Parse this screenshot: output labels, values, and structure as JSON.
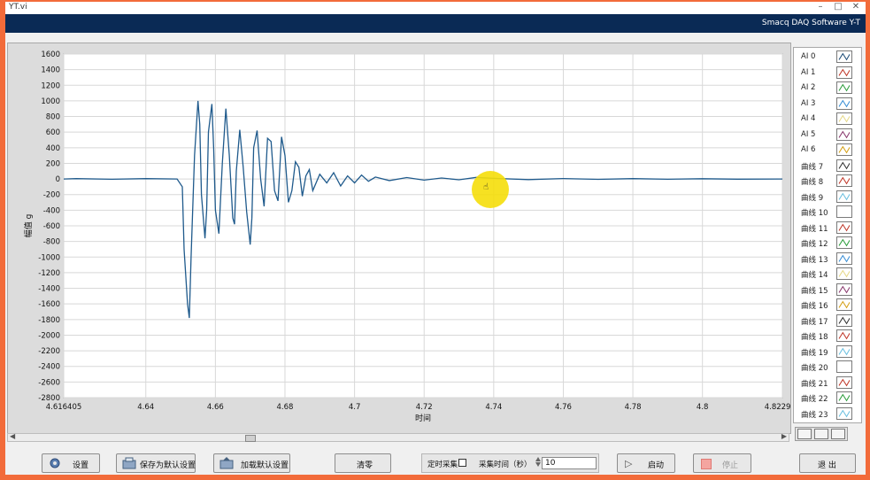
{
  "window": {
    "title": "YT.vi",
    "controls": [
      "–",
      "□",
      "✕"
    ],
    "brand": "Smacq DAQ Software Y-T"
  },
  "chart_data": {
    "type": "line",
    "xlabel": "时间",
    "ylabel": "幅值 g",
    "xlim": [
      4.616405,
      4.822974
    ],
    "ylim": [
      -2800,
      1600
    ],
    "x_ticks": [
      "4.616405",
      "4.64",
      "4.66",
      "4.68",
      "4.7",
      "4.72",
      "4.74",
      "4.76",
      "4.78",
      "4.8",
      "4.822974"
    ],
    "y_ticks": [
      "1600",
      "1400",
      "1200",
      "1000",
      "800",
      "600",
      "400",
      "200",
      "0",
      "-200",
      "-400",
      "-600",
      "-800",
      "-1000",
      "-1200",
      "-1400",
      "-1600",
      "-1800",
      "-2000",
      "-2200",
      "-2400",
      "-2600",
      "-2800"
    ],
    "grid": true,
    "line_color": "#1f5a8c",
    "series": [
      {
        "x": [
          4.616405,
          4.62,
          4.63,
          4.64,
          4.649,
          4.6505,
          4.651,
          4.652,
          4.6525,
          4.653,
          4.654,
          4.655,
          4.6555,
          4.656,
          4.657,
          4.6575,
          4.658,
          4.659,
          4.6595,
          4.66,
          4.661,
          4.662,
          4.663,
          4.664,
          4.665,
          4.6655,
          4.666,
          4.667,
          4.668,
          4.669,
          4.67,
          4.6705,
          4.671,
          4.672,
          4.673,
          4.674,
          4.675,
          4.676,
          4.677,
          4.678,
          4.679,
          4.68,
          4.681,
          4.682,
          4.683,
          4.684,
          4.685,
          4.686,
          4.687,
          4.688,
          4.69,
          4.692,
          4.694,
          4.696,
          4.698,
          4.7,
          4.702,
          4.704,
          4.706,
          4.71,
          4.715,
          4.72,
          4.725,
          4.73,
          4.735,
          4.74,
          4.75,
          4.76,
          4.77,
          4.78,
          4.79,
          4.8,
          4.81,
          4.822974
        ],
        "y": [
          0,
          5,
          -3,
          4,
          0,
          -100,
          -900,
          -1600,
          -1780,
          -1000,
          300,
          1000,
          700,
          -200,
          -760,
          -400,
          600,
          960,
          400,
          -400,
          -700,
          200,
          900,
          300,
          -500,
          -580,
          100,
          630,
          150,
          -420,
          -840,
          -500,
          400,
          620,
          0,
          -350,
          520,
          480,
          -150,
          -280,
          540,
          300,
          -300,
          -150,
          220,
          150,
          -220,
          40,
          120,
          -150,
          60,
          -50,
          80,
          -90,
          40,
          -50,
          50,
          -30,
          25,
          -20,
          18,
          -15,
          12,
          -10,
          20,
          8,
          -8,
          6,
          -5,
          4,
          -3,
          3,
          -2,
          0
        ]
      }
    ]
  },
  "legend": [
    {
      "name": "AI 0",
      "color": "#1f4e79"
    },
    {
      "name": "AI 1",
      "color": "#c0392b"
    },
    {
      "name": "AI 2",
      "color": "#2e9e3e"
    },
    {
      "name": "AI 3",
      "color": "#3a8fd6"
    },
    {
      "name": "AI 4",
      "color": "#e6d98a"
    },
    {
      "name": "AI 5",
      "color": "#8a3a6e"
    },
    {
      "name": "AI 6",
      "color": "#d4a017"
    },
    {
      "name": "曲线 7",
      "color": "#333333"
    },
    {
      "name": "曲线 8",
      "color": "#c0392b"
    },
    {
      "name": "曲线 9",
      "color": "#6cc0e0"
    },
    {
      "name": "曲线 10",
      "color": "#ffffff"
    },
    {
      "name": "曲线 11",
      "color": "#c0392b"
    },
    {
      "name": "曲线 12",
      "color": "#2e9e3e"
    },
    {
      "name": "曲线 13",
      "color": "#3a8fd6"
    },
    {
      "name": "曲线 14",
      "color": "#e6d98a"
    },
    {
      "name": "曲线 15",
      "color": "#8a3a6e"
    },
    {
      "name": "曲线 16",
      "color": "#d4a017"
    },
    {
      "name": "曲线 17",
      "color": "#333333"
    },
    {
      "name": "曲线 18",
      "color": "#c0392b"
    },
    {
      "name": "曲线 19",
      "color": "#6cc0e0"
    },
    {
      "name": "曲线 20",
      "color": "#ffffff"
    },
    {
      "name": "曲线 21",
      "color": "#c0392b"
    },
    {
      "name": "曲线 22",
      "color": "#2e9e3e"
    },
    {
      "name": "曲线 23",
      "color": "#6cc0e0"
    }
  ],
  "toolbar": {
    "settings_label": "设置",
    "save_default_label": "保存为默认设置",
    "load_default_label": "加载默认设置",
    "zero_label": "清零",
    "timed_acq_label": "定时采集",
    "acq_time_label": "采集时间（秒）",
    "acq_time_value": "10",
    "start_label": "启动",
    "stop_label": "停止",
    "exit_label": "退 出"
  }
}
